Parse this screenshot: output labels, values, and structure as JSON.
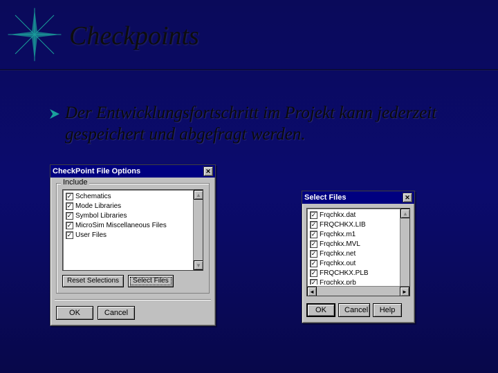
{
  "slide": {
    "title": "Checkpoints",
    "bullet": "Der Entwicklungsfortschritt im Projekt kann jederzeit gespeichert und abgefragt werden."
  },
  "dialog1": {
    "title": "CheckPoint File Options",
    "group_label": "Include",
    "items": [
      "Schematics",
      "Mode Libraries",
      "Symbol Libraries",
      "MicroSim Miscellaneous Files",
      "User Files"
    ],
    "reset_label": "Reset Selections",
    "select_files_label": "Select Files",
    "ok": "OK",
    "cancel": "Cancel"
  },
  "dialog2": {
    "title": "Select Files",
    "items": [
      "Frqchkx.dat",
      "FRQCHKX.LIB",
      "Frqchkx.m1",
      "Frqchkx.MVL",
      "Frqchkx.net",
      "Frqchkx.out",
      "FRQCHKX.PLB",
      "Frqchkx.prb"
    ],
    "ok": "OK",
    "cancel": "Cancel",
    "help": "Help"
  }
}
